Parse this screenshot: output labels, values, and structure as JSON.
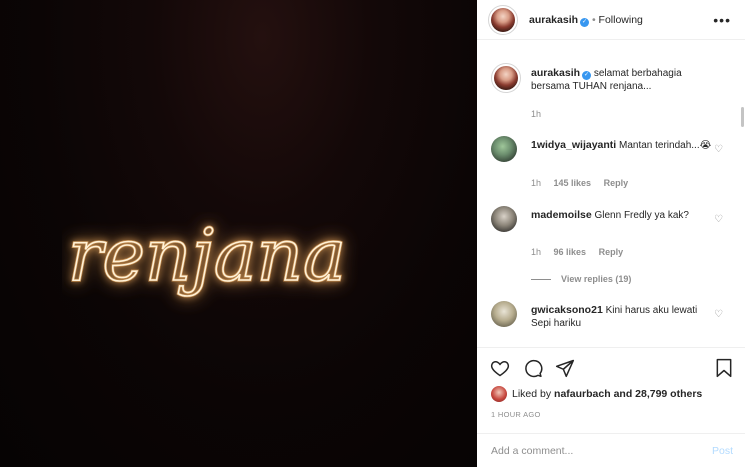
{
  "post": {
    "neon_text": "renjana",
    "author": {
      "username": "aurakasih",
      "follow_status": "Following",
      "verified": true
    },
    "caption": {
      "username": "aurakasih",
      "text": "selamat berbahagia bersama TUHAN renjana...",
      "time": "1h"
    },
    "comments": [
      {
        "username": "1widya_wijayanti",
        "text": "Mantan terindah...😭",
        "time": "1h",
        "likes": "145 likes",
        "reply": "Reply"
      },
      {
        "username": "mademoilse",
        "text": "Glenn Fredly ya kak?",
        "time": "1h",
        "likes": "96 likes",
        "reply": "Reply",
        "view_replies": "View replies (19)"
      },
      {
        "username": "gwicaksono21",
        "text": "Kini harus aku lewati",
        "text2": "Sepi hariku"
      }
    ],
    "liked_by": {
      "prefix": "Liked by",
      "user": "nafaurbach",
      "suffix": "and 28,799 others"
    },
    "timestamp": "1 HOUR AGO",
    "add_comment": {
      "placeholder": "Add a comment...",
      "post_label": "Post"
    }
  },
  "colors": {
    "neon": "#f7d7a6",
    "neon_glow": "#e8a55a",
    "verified": "#3897f0",
    "post_disabled": "#b3dbff"
  },
  "icons": [
    "heart-icon",
    "comment-icon",
    "share-icon",
    "bookmark-icon",
    "more-options-icon",
    "verified-badge-icon"
  ]
}
